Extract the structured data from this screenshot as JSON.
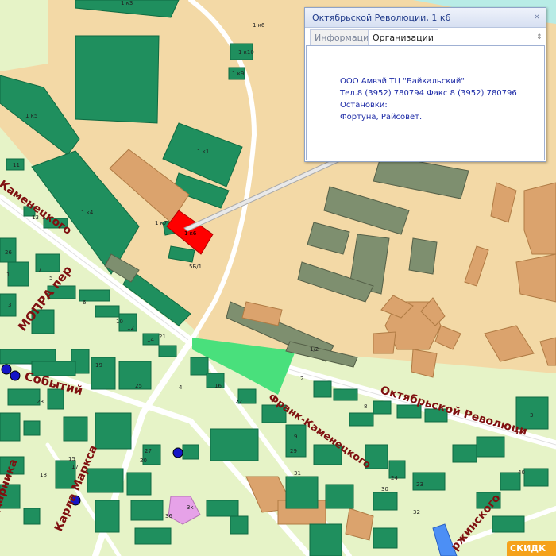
{
  "popup": {
    "title": "Октябрьской Революции, 1 к6",
    "close_icon": "close-icon",
    "tabs": [
      "Информация",
      "Организации"
    ],
    "active_tab": "Организации",
    "scroll_icon": "chevron-updown-icon",
    "organization": {
      "name": "ООО Амвэй  ТЦ \"Байкальский\"",
      "phone": "Тел.8 (3952) 780794 Факс 8 (3952) 780796",
      "stops_label": "Остановки:",
      "stops": "Фортуна, Райсовет."
    }
  },
  "streets": {
    "kamenetskogo": "Каменецкого",
    "mopra": "МОПРА пер",
    "sobytiy": "Событий",
    "oktyabrskoy": "Октябрьской Революци",
    "frank_kamenetskogo": "Франк-Каменецкого",
    "karla_marksa": "Карла Маркса",
    "dzerzhinskogo": "ржинского",
    "darnika": "дарника"
  },
  "building_labels": {
    "b1k3": "1 к3",
    "b1k6_top": "1 к6",
    "b1k10": "1 к10",
    "b1k9": "1 к9",
    "b1k5": "1 к5",
    "b1k1": "1 к1",
    "b1k4": "1 к4",
    "b1k7": "1 к7",
    "b1k8": "1 к8",
    "b1k2": "1/2",
    "b5bk1": "5Б/1",
    "b11": "11",
    "b16": "16",
    "b13": "13",
    "b23": "23",
    "b24": "24",
    "b20": "20",
    "b30": "30",
    "b32": "32",
    "b3": "3",
    "b5": "5",
    "b4": "4",
    "b6": "6",
    "b8": "8",
    "b9": "9",
    "b10": "10",
    "b14": "14",
    "b12": "12",
    "b1": "1",
    "b2": "2",
    "b7": "7",
    "b19": "19",
    "b21": "21",
    "b22": "22",
    "b26": "26",
    "b15": "15",
    "b17": "17",
    "b18": "18",
    "b25": "25",
    "b27": "27",
    "b28": "28",
    "b29": "29",
    "b31": "31",
    "b34": "3к",
    "b36": "36",
    "b40": "40"
  },
  "highlight_label": "1 к6",
  "discount_badge": "СКИДК",
  "colors": {
    "industrial": "#f3d9a6",
    "residential": "#e6f3c7",
    "building_green": "#1f8f5e",
    "building_orange": "#dba36d",
    "building_gray": "#7e8f6f",
    "highlight": "#ff0000",
    "park": "#49e07c",
    "street_label": "#7f1010",
    "stop": "#1515c7"
  }
}
